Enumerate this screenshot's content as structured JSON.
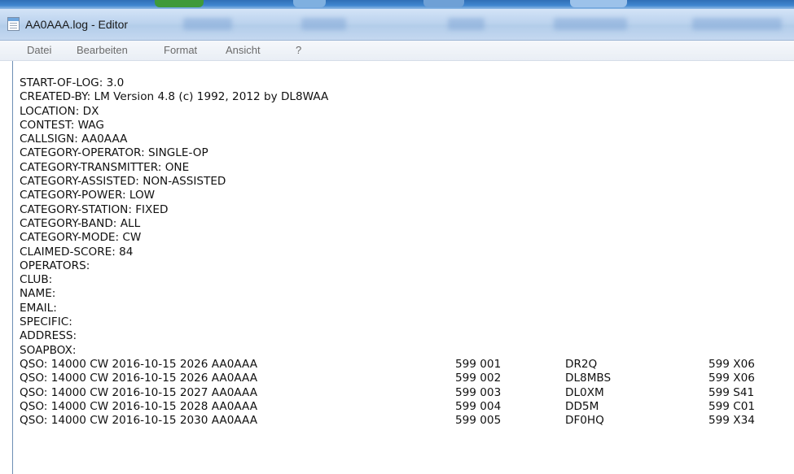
{
  "window": {
    "title": "AA0AAA.log - Editor"
  },
  "menu": {
    "items": [
      "Datei",
      "Bearbeiten",
      "Format",
      "Ansicht",
      "?"
    ]
  },
  "log": {
    "header_lines": [
      "START-OF-LOG: 3.0",
      "CREATED-BY: LM Version 4.8 (c) 1992, 2012 by DL8WAA",
      "LOCATION: DX",
      "CONTEST: WAG",
      "CALLSIGN: AA0AAA",
      "CATEGORY-OPERATOR: SINGLE-OP",
      "CATEGORY-TRANSMITTER: ONE",
      "CATEGORY-ASSISTED: NON-ASSISTED",
      "CATEGORY-POWER: LOW",
      "CATEGORY-STATION: FIXED",
      "CATEGORY-BAND: ALL",
      "CATEGORY-MODE: CW",
      "CLAIMED-SCORE: 84",
      "OPERATORS:",
      "CLUB:",
      "NAME:",
      "EMAIL:",
      "SPECIFIC:",
      "ADDRESS:",
      "SOAPBOX:"
    ],
    "qsos": [
      {
        "main": "QSO: 14000 CW 2016-10-15 2026 AA0AAA",
        "sent": "599 001",
        "call": "DR2Q",
        "rcvd": "599 X06"
      },
      {
        "main": "QSO: 14000 CW 2016-10-15 2026 AA0AAA",
        "sent": "599 002",
        "call": "DL8MBS",
        "rcvd": "599 X06"
      },
      {
        "main": "QSO: 14000 CW 2016-10-15 2027 AA0AAA",
        "sent": "599 003",
        "call": "DL0XM",
        "rcvd": "599 S41"
      },
      {
        "main": "QSO: 14000 CW 2016-10-15 2028 AA0AAA",
        "sent": "599 004",
        "call": "DD5M",
        "rcvd": "599 C01"
      },
      {
        "main": "QSO: 14000 CW 2016-10-15 2030 AA0AAA",
        "sent": "599 005",
        "call": "DF0HQ",
        "rcvd": "599 X34"
      }
    ]
  },
  "icons": {
    "app": "notepad-icon"
  },
  "colors": {
    "titlebar": "#bcd3ee",
    "menubar": "#eef2f7",
    "menu_text": "#6b6b6b",
    "editor_bg": "#ffffff",
    "text": "#111111"
  }
}
